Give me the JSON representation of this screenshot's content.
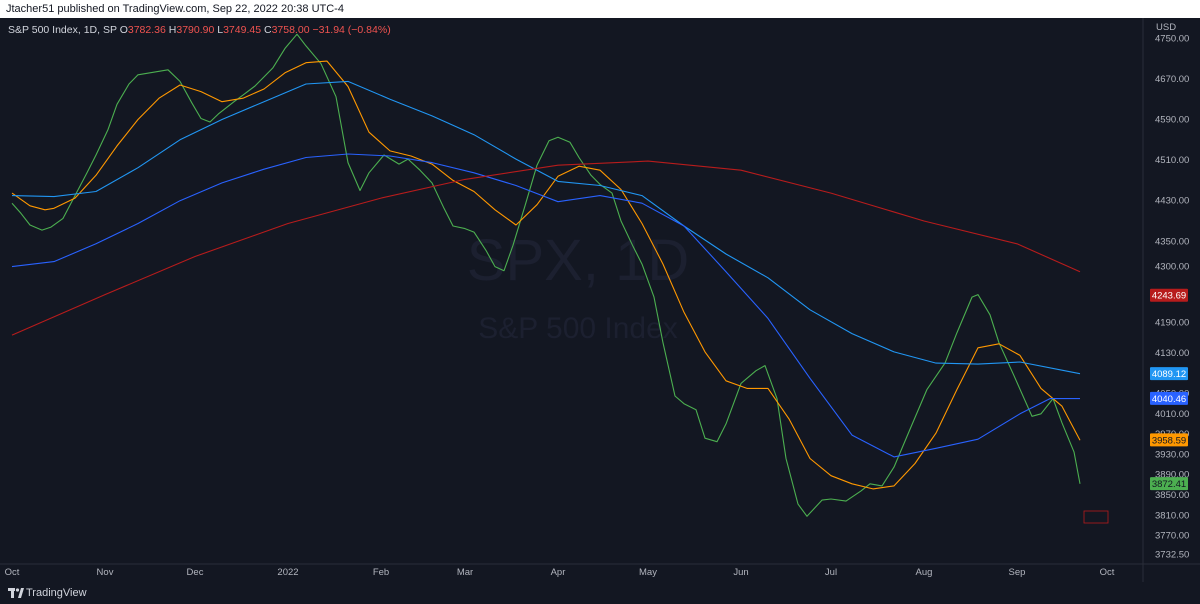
{
  "header": {
    "published": "Jtacher51 published on TradingView.com, Sep 22, 2022 20:38 UTC-4"
  },
  "legend": {
    "symbol": "S&P 500 Index, 1D, SP",
    "o_label": "O",
    "o_value": "3782.36",
    "h_label": "H",
    "h_value": "3790.90",
    "l_label": "L",
    "l_value": "3749.45",
    "c_label": "C",
    "c_value": "3758.00",
    "change": "−31.94 (−0.84%)"
  },
  "watermark": {
    "symbol": "SPX, 1D",
    "name": "S&P 500 Index"
  },
  "footer": {
    "brand": "TradingView"
  },
  "colors": {
    "background": "#131722",
    "green": "#4caf50",
    "orange": "#ff9800",
    "lightblue": "#2196f3",
    "blue": "#2962ff",
    "red": "#b71c1c"
  },
  "chart_data": {
    "type": "line",
    "currency": "USD",
    "xlabels": [
      "Oct",
      "Nov",
      "Dec",
      "2022",
      "Feb",
      "Mar",
      "Apr",
      "May",
      "Jun",
      "Jul",
      "Aug",
      "Sep",
      "Oct"
    ],
    "ylim": [
      3714,
      4790
    ],
    "yticks": [
      "4750.00",
      "4670.00",
      "4590.00",
      "4510.00",
      "4430.00",
      "4350.00",
      "4300.00",
      "4190.00",
      "4130.00",
      "4050.00",
      "4010.00",
      "3970.00",
      "3930.00",
      "3890.00",
      "3850.00",
      "3810.00",
      "3770.00",
      "3732.50"
    ],
    "series": [
      {
        "color": "#4caf50",
        "last_label": "3872.41",
        "points": [
          [
            "2021-10-01",
            4425
          ],
          [
            "2021-10-04",
            4405
          ],
          [
            "2021-10-07",
            4382
          ],
          [
            "2021-10-11",
            4372
          ],
          [
            "2021-10-14",
            4378
          ],
          [
            "2021-10-18",
            4395
          ],
          [
            "2021-10-22",
            4440
          ],
          [
            "2021-10-26",
            4485
          ],
          [
            "2021-10-29",
            4520
          ],
          [
            "2021-11-02",
            4570
          ],
          [
            "2021-11-05",
            4620
          ],
          [
            "2021-11-09",
            4660
          ],
          [
            "2021-11-12",
            4678
          ],
          [
            "2021-11-17",
            4683
          ],
          [
            "2021-11-22",
            4688
          ],
          [
            "2021-11-26",
            4665
          ],
          [
            "2021-11-30",
            4622
          ],
          [
            "2021-12-03",
            4592
          ],
          [
            "2021-12-06",
            4585
          ],
          [
            "2021-12-09",
            4602
          ],
          [
            "2021-12-14",
            4625
          ],
          [
            "2021-12-17",
            4638
          ],
          [
            "2021-12-21",
            4656
          ],
          [
            "2021-12-27",
            4692
          ],
          [
            "2021-12-31",
            4730
          ],
          [
            "2022-01-04",
            4758
          ],
          [
            "2022-01-07",
            4735
          ],
          [
            "2022-01-12",
            4700
          ],
          [
            "2022-01-17",
            4635
          ],
          [
            "2022-01-21",
            4505
          ],
          [
            "2022-01-25",
            4450
          ],
          [
            "2022-01-28",
            4485
          ],
          [
            "2022-02-02",
            4520
          ],
          [
            "2022-02-07",
            4502
          ],
          [
            "2022-02-10",
            4512
          ],
          [
            "2022-02-14",
            4490
          ],
          [
            "2022-02-18",
            4465
          ],
          [
            "2022-02-22",
            4415
          ],
          [
            "2022-02-25",
            4380
          ],
          [
            "2022-03-01",
            4375
          ],
          [
            "2022-03-04",
            4368
          ],
          [
            "2022-03-08",
            4332
          ],
          [
            "2022-03-11",
            4300
          ],
          [
            "2022-03-14",
            4292
          ],
          [
            "2022-03-17",
            4342
          ],
          [
            "2022-03-21",
            4420
          ],
          [
            "2022-03-25",
            4500
          ],
          [
            "2022-03-29",
            4548
          ],
          [
            "2022-04-01",
            4555
          ],
          [
            "2022-04-05",
            4545
          ],
          [
            "2022-04-08",
            4515
          ],
          [
            "2022-04-12",
            4480
          ],
          [
            "2022-04-15",
            4462
          ],
          [
            "2022-04-19",
            4445
          ],
          [
            "2022-04-22",
            4390
          ],
          [
            "2022-04-26",
            4340
          ],
          [
            "2022-04-29",
            4305
          ],
          [
            "2022-05-03",
            4240
          ],
          [
            "2022-05-06",
            4150
          ],
          [
            "2022-05-10",
            4045
          ],
          [
            "2022-05-13",
            4030
          ],
          [
            "2022-05-17",
            4018
          ],
          [
            "2022-05-20",
            3962
          ],
          [
            "2022-05-24",
            3955
          ],
          [
            "2022-05-27",
            3990
          ],
          [
            "2022-06-01",
            4070
          ],
          [
            "2022-06-06",
            4095
          ],
          [
            "2022-06-09",
            4105
          ],
          [
            "2022-06-13",
            4040
          ],
          [
            "2022-06-16",
            3922
          ],
          [
            "2022-06-20",
            3832
          ],
          [
            "2022-06-23",
            3808
          ],
          [
            "2022-06-28",
            3840
          ],
          [
            "2022-07-01",
            3842
          ],
          [
            "2022-07-06",
            3838
          ],
          [
            "2022-07-11",
            3858
          ],
          [
            "2022-07-14",
            3872
          ],
          [
            "2022-07-18",
            3868
          ],
          [
            "2022-07-22",
            3905
          ],
          [
            "2022-07-27",
            3975
          ],
          [
            "2022-08-02",
            4058
          ],
          [
            "2022-08-08",
            4110
          ],
          [
            "2022-08-12",
            4170
          ],
          [
            "2022-08-17",
            4240
          ],
          [
            "2022-08-19",
            4245
          ],
          [
            "2022-08-23",
            4205
          ],
          [
            "2022-08-26",
            4150
          ],
          [
            "2022-08-31",
            4085
          ],
          [
            "2022-09-06",
            4005
          ],
          [
            "2022-09-09",
            4010
          ],
          [
            "2022-09-13",
            4040
          ],
          [
            "2022-09-16",
            3992
          ],
          [
            "2022-09-20",
            3935
          ],
          [
            "2022-09-22",
            3872
          ]
        ]
      },
      {
        "color": "#ff9800",
        "last_label": "3958.59",
        "points": [
          [
            "2021-10-01",
            4445
          ],
          [
            "2021-10-07",
            4420
          ],
          [
            "2021-10-12",
            4412
          ],
          [
            "2021-10-15",
            4415
          ],
          [
            "2021-10-22",
            4435
          ],
          [
            "2021-10-29",
            4480
          ],
          [
            "2021-11-05",
            4538
          ],
          [
            "2021-11-12",
            4590
          ],
          [
            "2021-11-19",
            4632
          ],
          [
            "2021-11-26",
            4658
          ],
          [
            "2021-12-03",
            4645
          ],
          [
            "2021-12-10",
            4625
          ],
          [
            "2021-12-17",
            4632
          ],
          [
            "2021-12-24",
            4650
          ],
          [
            "2021-12-31",
            4682
          ],
          [
            "2022-01-07",
            4702
          ],
          [
            "2022-01-14",
            4705
          ],
          [
            "2022-01-21",
            4655
          ],
          [
            "2022-01-28",
            4565
          ],
          [
            "2022-02-04",
            4528
          ],
          [
            "2022-02-11",
            4518
          ],
          [
            "2022-02-18",
            4502
          ],
          [
            "2022-02-25",
            4470
          ],
          [
            "2022-03-04",
            4448
          ],
          [
            "2022-03-11",
            4412
          ],
          [
            "2022-03-18",
            4382
          ],
          [
            "2022-03-25",
            4422
          ],
          [
            "2022-04-01",
            4478
          ],
          [
            "2022-04-08",
            4498
          ],
          [
            "2022-04-15",
            4490
          ],
          [
            "2022-04-22",
            4452
          ],
          [
            "2022-04-29",
            4385
          ],
          [
            "2022-05-06",
            4305
          ],
          [
            "2022-05-13",
            4210
          ],
          [
            "2022-05-20",
            4132
          ],
          [
            "2022-05-27",
            4075
          ],
          [
            "2022-06-03",
            4060
          ],
          [
            "2022-06-10",
            4060
          ],
          [
            "2022-06-17",
            4000
          ],
          [
            "2022-06-24",
            3922
          ],
          [
            "2022-07-01",
            3888
          ],
          [
            "2022-07-08",
            3872
          ],
          [
            "2022-07-15",
            3862
          ],
          [
            "2022-07-22",
            3868
          ],
          [
            "2022-07-29",
            3912
          ],
          [
            "2022-08-05",
            3972
          ],
          [
            "2022-08-12",
            4058
          ],
          [
            "2022-08-19",
            4140
          ],
          [
            "2022-08-26",
            4148
          ],
          [
            "2022-09-02",
            4125
          ],
          [
            "2022-09-09",
            4060
          ],
          [
            "2022-09-16",
            4025
          ],
          [
            "2022-09-22",
            3958
          ]
        ]
      },
      {
        "color": "#2196f3",
        "last_label": "4089.12",
        "points": [
          [
            "2021-10-01",
            4440
          ],
          [
            "2021-10-15",
            4438
          ],
          [
            "2021-10-29",
            4448
          ],
          [
            "2021-11-12",
            4495
          ],
          [
            "2021-11-26",
            4550
          ],
          [
            "2021-12-10",
            4590
          ],
          [
            "2021-12-24",
            4625
          ],
          [
            "2022-01-07",
            4660
          ],
          [
            "2022-01-21",
            4665
          ],
          [
            "2022-02-04",
            4630
          ],
          [
            "2022-02-18",
            4597
          ],
          [
            "2022-03-04",
            4560
          ],
          [
            "2022-03-18",
            4512
          ],
          [
            "2022-04-01",
            4468
          ],
          [
            "2022-04-15",
            4460
          ],
          [
            "2022-04-29",
            4440
          ],
          [
            "2022-05-13",
            4380
          ],
          [
            "2022-05-27",
            4325
          ],
          [
            "2022-06-10",
            4278
          ],
          [
            "2022-06-24",
            4215
          ],
          [
            "2022-07-08",
            4168
          ],
          [
            "2022-07-22",
            4132
          ],
          [
            "2022-08-05",
            4110
          ],
          [
            "2022-08-19",
            4108
          ],
          [
            "2022-09-02",
            4112
          ],
          [
            "2022-09-16",
            4096
          ],
          [
            "2022-09-22",
            4089
          ]
        ]
      },
      {
        "color": "#2962ff",
        "last_label": "4040.46",
        "points": [
          [
            "2021-10-01",
            4300
          ],
          [
            "2021-10-15",
            4310
          ],
          [
            "2021-10-29",
            4345
          ],
          [
            "2021-11-12",
            4385
          ],
          [
            "2021-11-26",
            4430
          ],
          [
            "2021-12-10",
            4465
          ],
          [
            "2021-12-24",
            4492
          ],
          [
            "2022-01-07",
            4515
          ],
          [
            "2022-01-21",
            4522
          ],
          [
            "2022-02-04",
            4518
          ],
          [
            "2022-02-18",
            4505
          ],
          [
            "2022-03-04",
            4485
          ],
          [
            "2022-03-18",
            4460
          ],
          [
            "2022-04-01",
            4428
          ],
          [
            "2022-04-15",
            4440
          ],
          [
            "2022-04-29",
            4425
          ],
          [
            "2022-05-13",
            4380
          ],
          [
            "2022-05-27",
            4290
          ],
          [
            "2022-06-10",
            4198
          ],
          [
            "2022-06-24",
            4080
          ],
          [
            "2022-07-08",
            3968
          ],
          [
            "2022-07-22",
            3925
          ],
          [
            "2022-08-05",
            3942
          ],
          [
            "2022-08-19",
            3960
          ],
          [
            "2022-09-02",
            4010
          ],
          [
            "2022-09-12",
            4040
          ],
          [
            "2022-09-22",
            4040
          ]
        ]
      },
      {
        "color": "#b71c1c",
        "last_label": "4243.69",
        "points": [
          [
            "2021-10-01",
            4165
          ],
          [
            "2021-11-01",
            4245
          ],
          [
            "2021-12-01",
            4320
          ],
          [
            "2022-01-01",
            4385
          ],
          [
            "2022-02-01",
            4435
          ],
          [
            "2022-03-01",
            4472
          ],
          [
            "2022-04-01",
            4500
          ],
          [
            "2022-05-01",
            4508
          ],
          [
            "2022-06-01",
            4490
          ],
          [
            "2022-07-01",
            4445
          ],
          [
            "2022-08-01",
            4390
          ],
          [
            "2022-09-01",
            4345
          ],
          [
            "2022-09-22",
            4290
          ]
        ]
      }
    ]
  }
}
